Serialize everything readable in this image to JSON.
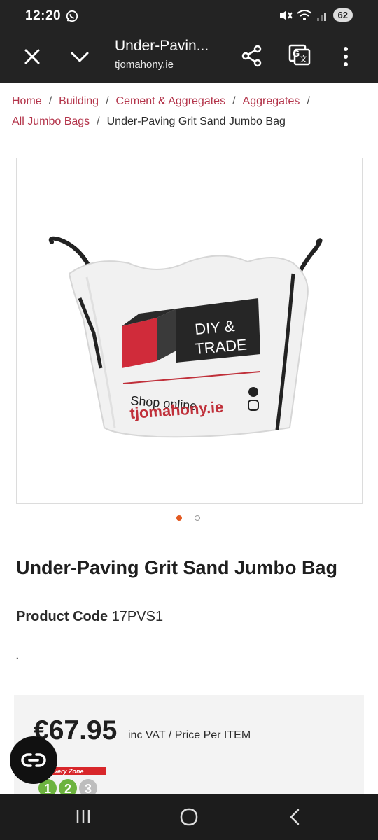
{
  "status_bar": {
    "time": "12:20",
    "battery": "62"
  },
  "browser": {
    "title": "Under-Pavin...",
    "url": "tjomahony.ie"
  },
  "breadcrumb": {
    "items": [
      "Home",
      "Building",
      "Cement & Aggregates",
      "Aggregates",
      "All Jumbo Bags"
    ],
    "current": "Under-Paving Grit Sand Jumbo Bag"
  },
  "gallery": {
    "bag_logo_line1": "DIY &",
    "bag_logo_line2": "TRADE",
    "bag_shop_text": "Shop online",
    "bag_site_text": "tjomahony.ie",
    "slide_count": 2,
    "active_slide": 1
  },
  "product": {
    "title": "Under-Paving Grit Sand Jumbo Bag",
    "code_label": "Product Code",
    "code_value": "17PVS1",
    "description": "."
  },
  "price": {
    "amount": "€67.95",
    "note": "inc VAT / Price Per ITEM"
  },
  "delivery_zone": {
    "label": "livery Zone",
    "zones": [
      "1",
      "2",
      "3"
    ]
  },
  "colors": {
    "brand_link": "#b3344a",
    "accent_dot": "#e35a22",
    "dark_bar": "#232323"
  }
}
